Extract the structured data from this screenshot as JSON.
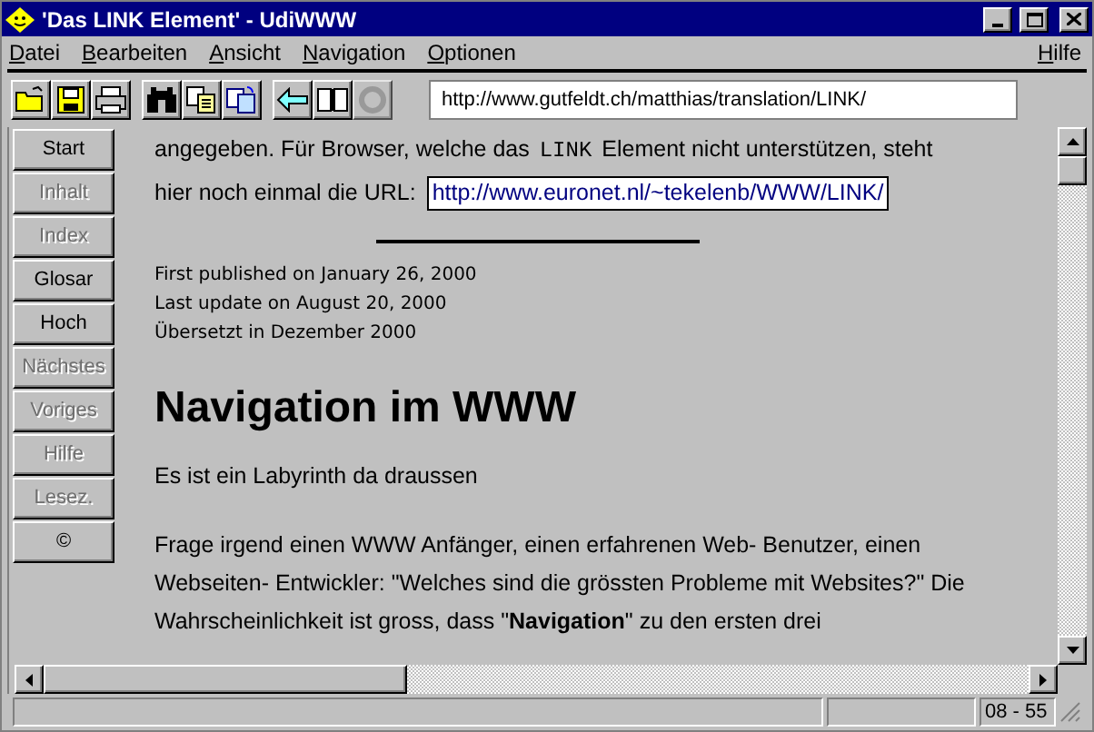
{
  "window": {
    "title": "'Das LINK Element' - UdiWWW"
  },
  "menu": [
    {
      "label": "Datei"
    },
    {
      "label": "Bearbeiten"
    },
    {
      "label": "Ansicht"
    },
    {
      "label": "Navigation"
    },
    {
      "label": "Optionen"
    }
  ],
  "menu_right": {
    "label": "Hilfe"
  },
  "toolbar": [
    {
      "kind": "open",
      "disabled": false
    },
    {
      "kind": "save",
      "disabled": false
    },
    {
      "kind": "print",
      "disabled": false
    },
    {
      "kind": "find",
      "disabled": false
    },
    {
      "kind": "copy",
      "disabled": false
    },
    {
      "kind": "paste",
      "disabled": false
    },
    {
      "kind": "back",
      "disabled": false
    },
    {
      "kind": "book",
      "disabled": false
    },
    {
      "kind": "stop",
      "disabled": true
    }
  ],
  "address": {
    "value": "http://www.gutfeldt.ch/matthias/translation/LINK/"
  },
  "sidebar": [
    {
      "label": "Start",
      "disabled": false
    },
    {
      "label": "Inhalt",
      "disabled": true
    },
    {
      "label": "Index",
      "disabled": true
    },
    {
      "label": "Glosar",
      "disabled": false
    },
    {
      "label": "Hoch",
      "disabled": false
    },
    {
      "label": "Nächstes",
      "disabled": true
    },
    {
      "label": "Voriges",
      "disabled": true
    },
    {
      "label": "Hilfe",
      "disabled": true
    },
    {
      "label": "Lesez.",
      "disabled": true
    },
    {
      "label": "©",
      "disabled": false
    }
  ],
  "content": {
    "line_1a": "angegeben. Für Browser, welche das",
    "code": "LINK",
    "line_1b": "Element nicht unterstützen, steht",
    "line_2": "hier noch einmal die URL:",
    "link": "http://www.euronet.nl/~tekelenb/WWW/LINK/",
    "meta": [
      "First published on January 26, 2000",
      "Last update on August 20, 2000",
      "Übersetzt in Dezember 2000"
    ],
    "heading": "Navigation im WWW",
    "paragraphs": [
      "Es ist ein Labyrinth da draussen",
      "Frage irgend einen WWW Anfänger, einen erfahrenen Web- Benutzer, einen Webseiten- Entwickler: \"Welches sind die grössten Probleme mit Websites?\" Die Wahrscheinlichkeit ist gross, dass \"**Navigation**\" zu den ersten drei"
    ]
  },
  "status_bar": {
    "position": "08 - 55"
  }
}
